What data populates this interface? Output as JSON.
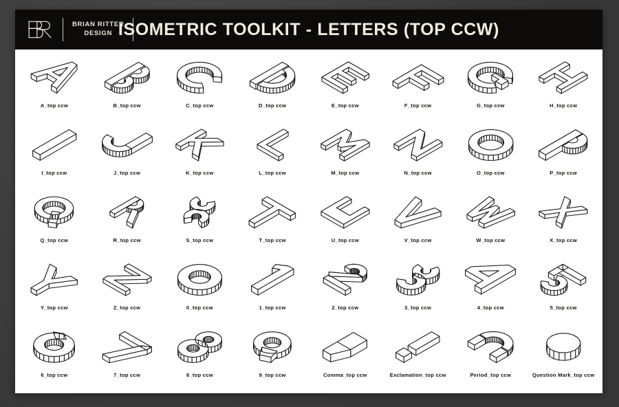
{
  "background": {
    "color": "#3b3b3b"
  },
  "page": {
    "background_color": "#ffffff"
  },
  "header": {
    "background_color": "#0c0b09",
    "text_color": "#f3ede0",
    "logo_name": "brd-monogram-logo",
    "brand_name": "BRIAN RITTER\nDESIGN",
    "title": "ISOMETRIC TOOLKIT - LETTERS (TOP CCW)"
  },
  "grid": {
    "columns": 8,
    "rows": 5,
    "line_color": "#1c1c1c",
    "fill_color": "#ffffff",
    "items": [
      {
        "label": "A_top ccw",
        "glyph": "A",
        "icon": "iso-letter-a-icon"
      },
      {
        "label": "B_top ccw",
        "glyph": "B",
        "icon": "iso-letter-b-icon"
      },
      {
        "label": "C_top ccw",
        "glyph": "C",
        "icon": "iso-letter-c-icon"
      },
      {
        "label": "D_top ccw",
        "glyph": "D",
        "icon": "iso-letter-d-icon"
      },
      {
        "label": "E_top ccw",
        "glyph": "E",
        "icon": "iso-letter-e-icon"
      },
      {
        "label": "F_top ccw",
        "glyph": "F",
        "icon": "iso-letter-f-icon"
      },
      {
        "label": "G_top ccw",
        "glyph": "G",
        "icon": "iso-letter-g-icon"
      },
      {
        "label": "H_top ccw",
        "glyph": "H",
        "icon": "iso-letter-h-icon"
      },
      {
        "label": "I_top ccw",
        "glyph": "I",
        "icon": "iso-letter-i-icon"
      },
      {
        "label": "J_top ccw",
        "glyph": "J",
        "icon": "iso-letter-j-icon"
      },
      {
        "label": "K_top ccw",
        "glyph": "K",
        "icon": "iso-letter-k-icon"
      },
      {
        "label": "L_top ccw",
        "glyph": "L",
        "icon": "iso-letter-l-icon"
      },
      {
        "label": "M_top ccw",
        "glyph": "M",
        "icon": "iso-letter-m-icon"
      },
      {
        "label": "N_top ccw",
        "glyph": "N",
        "icon": "iso-letter-n-icon"
      },
      {
        "label": "O_top ccw",
        "glyph": "O",
        "icon": "iso-letter-o-icon"
      },
      {
        "label": "P_top ccw",
        "glyph": "P",
        "icon": "iso-letter-p-icon"
      },
      {
        "label": "Q_top ccw",
        "glyph": "Q",
        "icon": "iso-letter-q-icon"
      },
      {
        "label": "R_top ccw",
        "glyph": "R",
        "icon": "iso-letter-r-icon"
      },
      {
        "label": "S_top ccw",
        "glyph": "S",
        "icon": "iso-letter-s-icon"
      },
      {
        "label": "T_top ccw",
        "glyph": "T",
        "icon": "iso-letter-t-icon"
      },
      {
        "label": "U_top ccw",
        "glyph": "U",
        "icon": "iso-letter-u-icon"
      },
      {
        "label": "V_top ccw",
        "glyph": "V",
        "icon": "iso-letter-v-icon"
      },
      {
        "label": "W_top ccw",
        "glyph": "W",
        "icon": "iso-letter-w-icon"
      },
      {
        "label": "X_top ccw",
        "glyph": "X",
        "icon": "iso-letter-x-icon"
      },
      {
        "label": "Y_top ccw",
        "glyph": "Y",
        "icon": "iso-letter-y-icon"
      },
      {
        "label": "Z_top ccw",
        "glyph": "Z",
        "icon": "iso-letter-z-icon"
      },
      {
        "label": "0_top ccw",
        "glyph": "0",
        "icon": "iso-digit-0-icon"
      },
      {
        "label": "1_top ccw",
        "glyph": "1",
        "icon": "iso-digit-1-icon"
      },
      {
        "label": "2_top ccw",
        "glyph": "2",
        "icon": "iso-digit-2-icon"
      },
      {
        "label": "3_top ccw",
        "glyph": "3",
        "icon": "iso-digit-3-icon"
      },
      {
        "label": "4_top ccw",
        "glyph": "4",
        "icon": "iso-digit-4-icon"
      },
      {
        "label": "5_top ccw",
        "glyph": "5",
        "icon": "iso-digit-5-icon"
      },
      {
        "label": "6_top ccw",
        "glyph": "6",
        "icon": "iso-digit-6-icon"
      },
      {
        "label": "7_top ccw",
        "glyph": "7",
        "icon": "iso-digit-7-icon"
      },
      {
        "label": "8_top ccw",
        "glyph": "8",
        "icon": "iso-digit-8-icon"
      },
      {
        "label": "9_top ccw",
        "glyph": "9",
        "icon": "iso-digit-9-icon"
      },
      {
        "label": "Comma_top ccw",
        "glyph": ",",
        "icon": "iso-comma-icon"
      },
      {
        "label": "Exclamation_top ccw",
        "glyph": "!",
        "icon": "iso-exclamation-icon"
      },
      {
        "label": "Period_top ccw",
        "glyph": ".",
        "icon": "iso-period-icon"
      },
      {
        "label": "Question Mark_top ccw",
        "glyph": "?",
        "icon": "iso-question-mark-icon"
      }
    ]
  }
}
